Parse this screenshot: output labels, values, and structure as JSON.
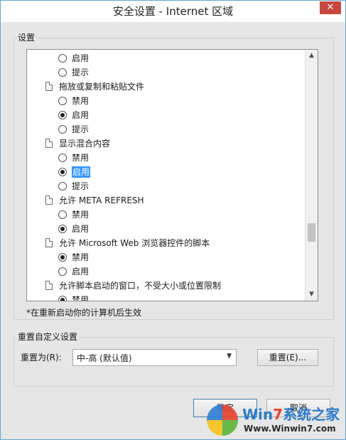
{
  "window": {
    "title": "安全设置 - Internet 区域",
    "close_glyph": "✕"
  },
  "settings": {
    "group_label": "设置",
    "rows": [
      {
        "kind": "option",
        "label": "启用",
        "checked": false
      },
      {
        "kind": "option",
        "label": "提示",
        "checked": false
      },
      {
        "kind": "category",
        "label": "拖放或复制和粘贴文件"
      },
      {
        "kind": "option",
        "label": "禁用",
        "checked": false
      },
      {
        "kind": "option",
        "label": "启用",
        "checked": true
      },
      {
        "kind": "option",
        "label": "提示",
        "checked": false
      },
      {
        "kind": "category",
        "label": "显示混合内容"
      },
      {
        "kind": "option",
        "label": "禁用",
        "checked": false
      },
      {
        "kind": "option",
        "label": "启用",
        "checked": true,
        "highlight": true
      },
      {
        "kind": "option",
        "label": "提示",
        "checked": false
      },
      {
        "kind": "category",
        "label": "允许 META REFRESH"
      },
      {
        "kind": "option",
        "label": "禁用",
        "checked": false
      },
      {
        "kind": "option",
        "label": "启用",
        "checked": true
      },
      {
        "kind": "category",
        "label": "允许 Microsoft Web 浏览器控件的脚本"
      },
      {
        "kind": "option",
        "label": "禁用",
        "checked": true
      },
      {
        "kind": "option",
        "label": "启用",
        "checked": false
      },
      {
        "kind": "category",
        "label": "允许脚本启动的窗口，不受大小或位置限制"
      },
      {
        "kind": "option",
        "label": "禁用",
        "checked": true
      }
    ],
    "note": "*在重新启动你的计算机后生效"
  },
  "reset": {
    "group_label": "重置自定义设置",
    "reset_to_label": "重置为(R):",
    "selected_level": "中-高 (默认值)",
    "reset_button": "重置(E)..."
  },
  "footer": {
    "ok_button": "确定",
    "cancel_button": "取消"
  },
  "watermark": {
    "brand_prefix": "Win",
    "brand_seven": "7",
    "brand_suffix": "系统之家",
    "url": "Www.Winwin7.com"
  },
  "colors": {
    "selection": "#3399ff",
    "close_button": "#c7483c",
    "window_border": "#5fa8d3"
  }
}
